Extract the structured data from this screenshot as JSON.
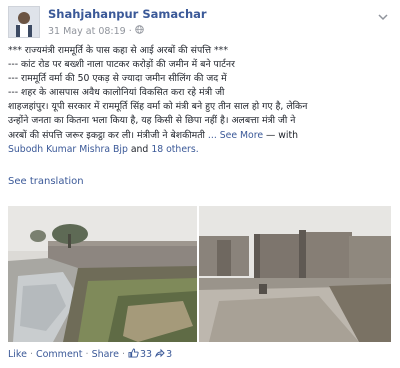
{
  "post": {
    "author": "Shahjahanpur Samachar",
    "timestamp": "31 May at 08:19",
    "lines": [
      "*** राज्यमंत्री राममूर्ति के पास कहा से आई अरबों की संपत्ति ***",
      "--- कांट रोड पर बख्शी नाला पाटकर करोड़ों की जमीन में बने पार्टनर",
      "--- राममूर्ति वर्मा की 50 एकड़ से ज्यादा जमीन सीलिंग की जद में",
      "--- शहर के आसपास अवैध कालोनियां विकसित करा रहे मंत्री जी",
      "शाहजहांपुर। यूपी सरकार में राममूर्ति सिंह वर्मा को मंत्री बने हुए तीन साल हो गए है, लेकिन",
      "उन्होंने जनता का कितना भला किया है, यह किसी से छिपा नहीं है। अलबत्ता मंत्री जी ने",
      "अरबों की संपत्ति जरूर इकट्ठा कर ली। मंत्रीजी ने बेशकीमती"
    ],
    "see_more": "... See More",
    "with_text": "— with",
    "tagged": "Subodh Kumar Mishra Bjp",
    "and_text": "and",
    "others": "18 others.",
    "see_translation": "See translation"
  },
  "actions": {
    "like": "Like",
    "comment": "Comment",
    "share": "Share",
    "sep": "·",
    "likes_count": "33",
    "shares_count": "3"
  },
  "icons": {
    "globe": "globe-icon",
    "chevron": "chevron-down-icon",
    "thumbs_up": "thumbs-up-icon",
    "share": "share-icon"
  },
  "colors": {
    "link": "#3b5998",
    "text": "#1d2129",
    "meta": "#90949c"
  }
}
